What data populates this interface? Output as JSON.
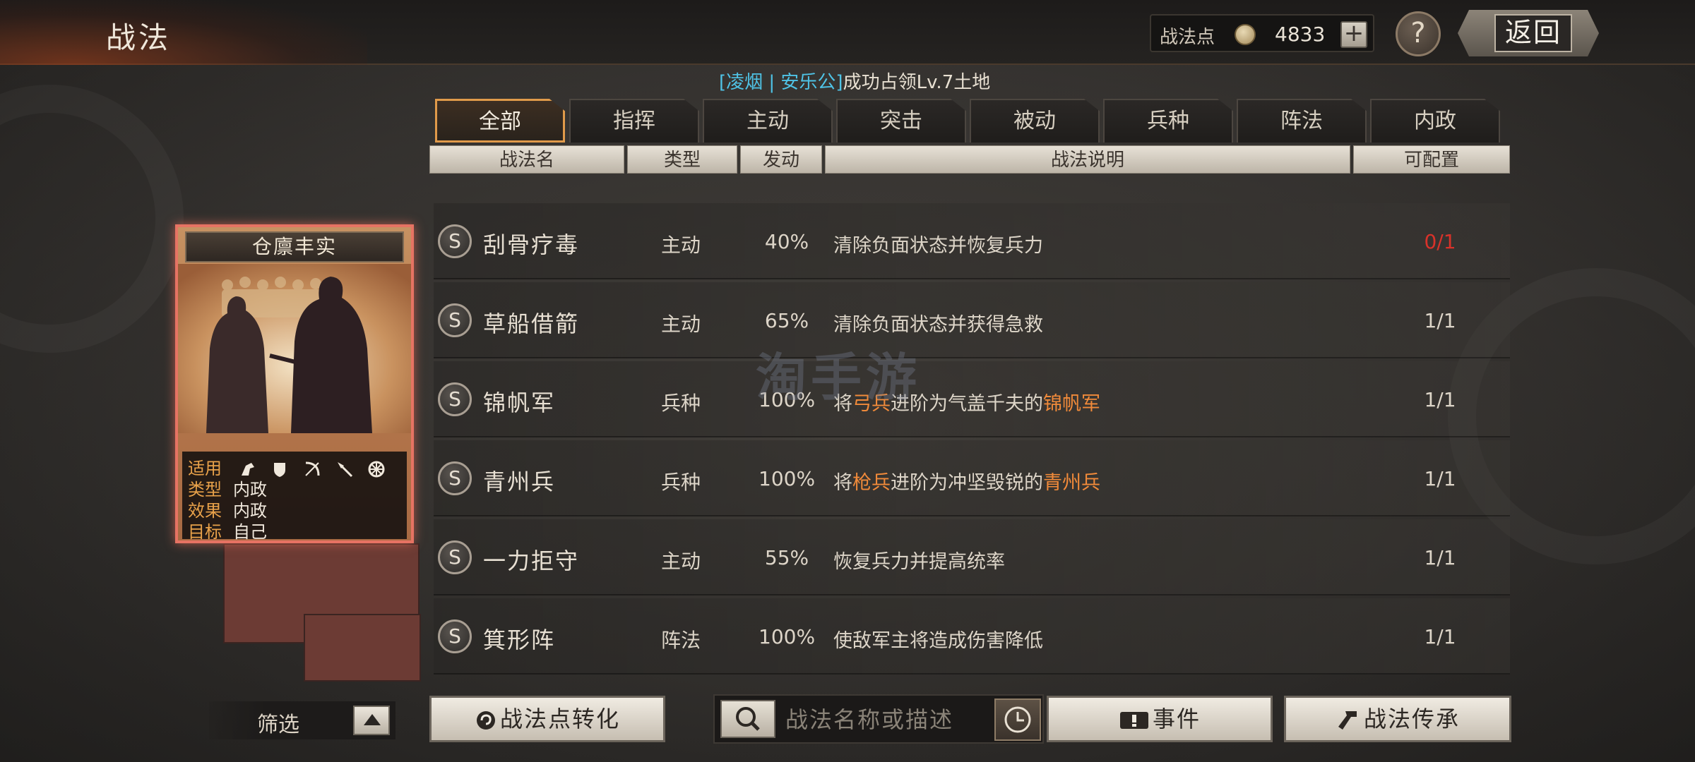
{
  "header": {
    "title": "战法",
    "points_label": "战法点",
    "points_value": "4833",
    "plus_label": "+",
    "help_label": "?",
    "back_label": "返回"
  },
  "notice": {
    "prefix": "[凌烟 | 安乐公]",
    "text": "成功占领Lv.7土地"
  },
  "tabs": [
    {
      "label": "全部",
      "active": true
    },
    {
      "label": "指挥",
      "active": false
    },
    {
      "label": "主动",
      "active": false
    },
    {
      "label": "突击",
      "active": false
    },
    {
      "label": "被动",
      "active": false
    },
    {
      "label": "兵种",
      "active": false
    },
    {
      "label": "阵法",
      "active": false
    },
    {
      "label": "内政",
      "active": false
    }
  ],
  "columns": {
    "name": "战法名",
    "type": "类型",
    "trigger": "发动",
    "desc": "战法说明",
    "config": "可配置"
  },
  "rows": [
    {
      "grade": "S",
      "name": "刮骨疗毒",
      "type": "主动",
      "rate": "40%",
      "desc": "清除负面状态并恢复兵力",
      "config": "0/1",
      "config_full": true
    },
    {
      "grade": "S",
      "name": "草船借箭",
      "type": "主动",
      "rate": "65%",
      "desc": "清除负面状态并获得急救",
      "config": "1/1",
      "config_full": false
    },
    {
      "grade": "S",
      "name": "锦帆军",
      "type": "兵种",
      "rate": "100%",
      "desc_parts": [
        "将",
        "弓兵",
        "进阶为气盖千夫的",
        "锦帆军"
      ],
      "config": "1/1",
      "config_full": false
    },
    {
      "grade": "S",
      "name": "青州兵",
      "type": "兵种",
      "rate": "100%",
      "desc_parts": [
        "将",
        "枪兵",
        "进阶为冲坚毁锐的",
        "青州兵"
      ],
      "config": "1/1",
      "config_full": false
    },
    {
      "grade": "S",
      "name": "一力拒守",
      "type": "主动",
      "rate": "55%",
      "desc": "恢复兵力并提高统率",
      "config": "1/1",
      "config_full": false
    },
    {
      "grade": "S",
      "name": "箕形阵",
      "type": "阵法",
      "rate": "100%",
      "desc": "使敌军主将造成伤害降低",
      "config": "1/1",
      "config_full": false
    }
  ],
  "card": {
    "title": "仓廪丰实",
    "apply_label": "适用",
    "unit_icons": [
      "cavalry-icon",
      "shield-icon",
      "bow-icon",
      "spear-icon",
      "wheel-icon"
    ],
    "type_label": "类型",
    "type_value": "内政",
    "effect_label": "效果",
    "effect_value": "内政",
    "target_label": "目标",
    "target_value": "自己"
  },
  "footer": {
    "filter_label": "筛选",
    "convert_label": "战法点转化",
    "search_placeholder": "战法名称或描述",
    "event_label": "事件",
    "inherit_label": "战法传承"
  },
  "watermark": "淘手游",
  "colors": {
    "accent_orange": "#f08a3a",
    "notice_blue": "#4fc3e6",
    "full_red": "#d8322a",
    "active_tab_border": "#e09a4a"
  }
}
